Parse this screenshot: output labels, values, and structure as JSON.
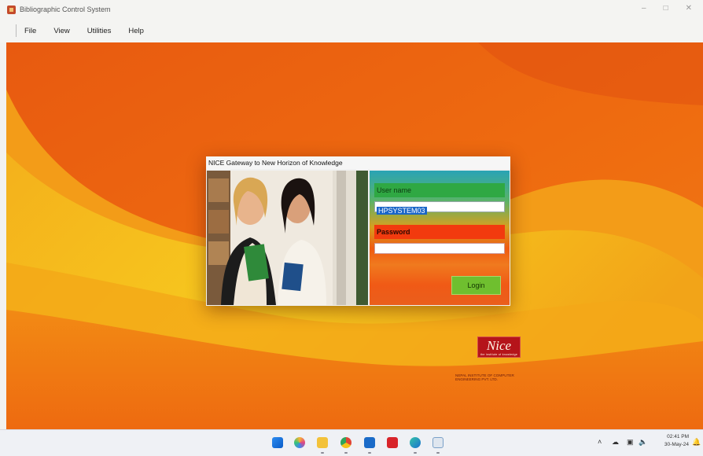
{
  "window": {
    "title": "Bibliographic Control System",
    "controls": [
      "minimize-icon",
      "maximize-icon",
      "close-icon"
    ]
  },
  "menu": {
    "items": [
      {
        "label": "File"
      },
      {
        "label": "View"
      },
      {
        "label": "Utilities"
      },
      {
        "label": "Help"
      }
    ]
  },
  "login_dialog": {
    "title": "NICE Gateway to  New Horizon of Knowledge",
    "username_label": "User name",
    "username_value": "HPSYSTEM03",
    "password_label": "Password",
    "password_value": "",
    "login_button": "Login"
  },
  "branding": {
    "logo_text": "Nice",
    "logo_tagline": "the institute of knowledge",
    "small_text": "Nepal Institute of Computer Engineering Pvt. Ltd."
  },
  "taskbar": {
    "icons": [
      "windows-start-icon",
      "copilot-icon",
      "file-explorer-icon",
      "chrome-icon",
      "outlook-icon",
      "acrobat-icon",
      "edge-icon",
      "notepad-icon"
    ],
    "time": "02:41 PM",
    "date": "30-May-24",
    "tray_icons": [
      "chevron-up-icon",
      "onedrive-icon",
      "display-icon",
      "volume-icon",
      "bell-icon"
    ]
  },
  "colors": {
    "desktop_orange": "#f06a0e",
    "desktop_yellow": "#f6c21a",
    "username_label_bg": "#2fa843",
    "password_label_bg": "#f23a0e",
    "login_button_bg": "#6fbf2f",
    "logo_red": "#b5141a"
  }
}
